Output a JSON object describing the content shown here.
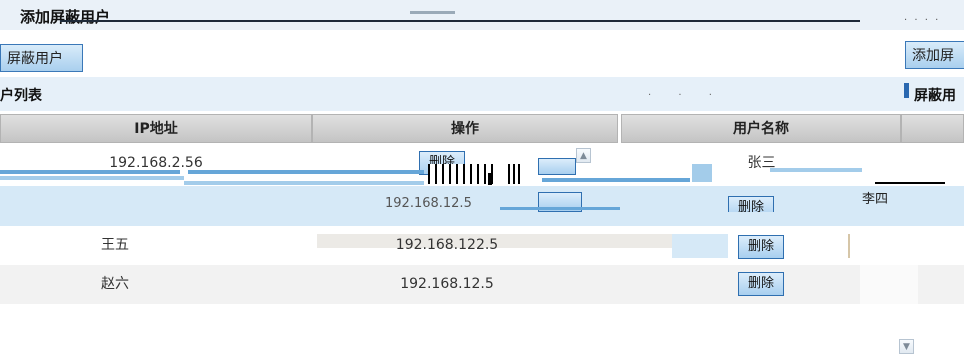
{
  "titlebar": {
    "title": "添加屏蔽用户"
  },
  "toolbar": {
    "left_button": "屏蔽用户",
    "right_button": "添加屏"
  },
  "section": {
    "title": "户列表",
    "right_label": "屏蔽用"
  },
  "table": {
    "columns": [
      "IP地址",
      "操作",
      "用户名称"
    ],
    "rows": [
      {
        "ip": "192.168.2.56",
        "user": "张三",
        "action": "删除"
      },
      {
        "user": "李四",
        "ip": "192.168.12.5",
        "action": "删除"
      },
      {
        "user": "王五",
        "ip": "192.168.122.5",
        "action": "删除"
      },
      {
        "user": "赵六",
        "ip": "192.168.12.5",
        "action": "删除"
      }
    ]
  },
  "overlay": {
    "ghost_ip": "192.168.12.5"
  },
  "icons": {
    "scroll_up": "chevron-up-icon",
    "scroll_down": "chevron-down-icon"
  },
  "colors": {
    "accent": "#3a78b8",
    "section_bg": "#e6f0f9",
    "header_bg": "#d0d0d0"
  }
}
